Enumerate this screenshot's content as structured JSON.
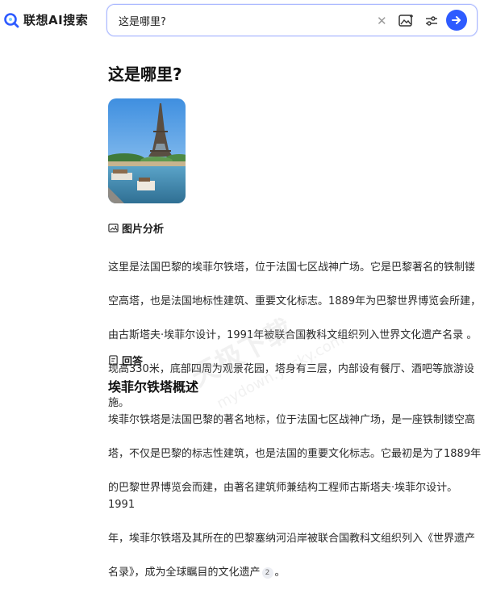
{
  "logo": {
    "text": "联想AI搜索"
  },
  "search": {
    "value": "这是哪里?"
  },
  "page_title": "这是哪里?",
  "image_analysis": {
    "heading": "图片分析",
    "text_lines": [
      "这里是法国巴黎的埃菲尔铁塔，位于法国七区战神广场。它是巴黎著名的铁制镂",
      "空高塔，也是法国地标性建筑、重要文化标志。1889年为巴黎世界博览会所建，",
      "由古斯塔夫·埃菲尔设计，1991年被联合国教科文组织列入世界文化遗产名录 。",
      "现高330米，底部四周为观景花园，塔身有三层，内部设有餐厅、酒吧等旅游设",
      "施。"
    ]
  },
  "answer": {
    "heading": "回答",
    "subtitle": "埃菲尔铁塔概述",
    "text_lines": [
      "埃菲尔铁塔是法国巴黎的著名地标，位于法国七区战神广场，是一座铁制镂空高",
      "塔，不仅是巴黎的标志性建筑，也是法国的重要文化标志。它最初是为了1889年",
      "的巴黎世界博览会而建，由著名建筑师兼结构工程师古斯塔夫·埃菲尔设计。1991",
      "年，埃菲尔铁塔及其所在的巴黎塞纳河沿岸被联合国教科文组织列入《世界遗产",
      "名录》，成为全球瞩目的文化遗产"
    ],
    "citation": "2",
    "tail": "。"
  },
  "watermark": {
    "text1": "天极下载",
    "text2": "mydown.yesky.com"
  },
  "colors": {
    "accent": "#2e5bff",
    "logo": "#2e5bff"
  }
}
